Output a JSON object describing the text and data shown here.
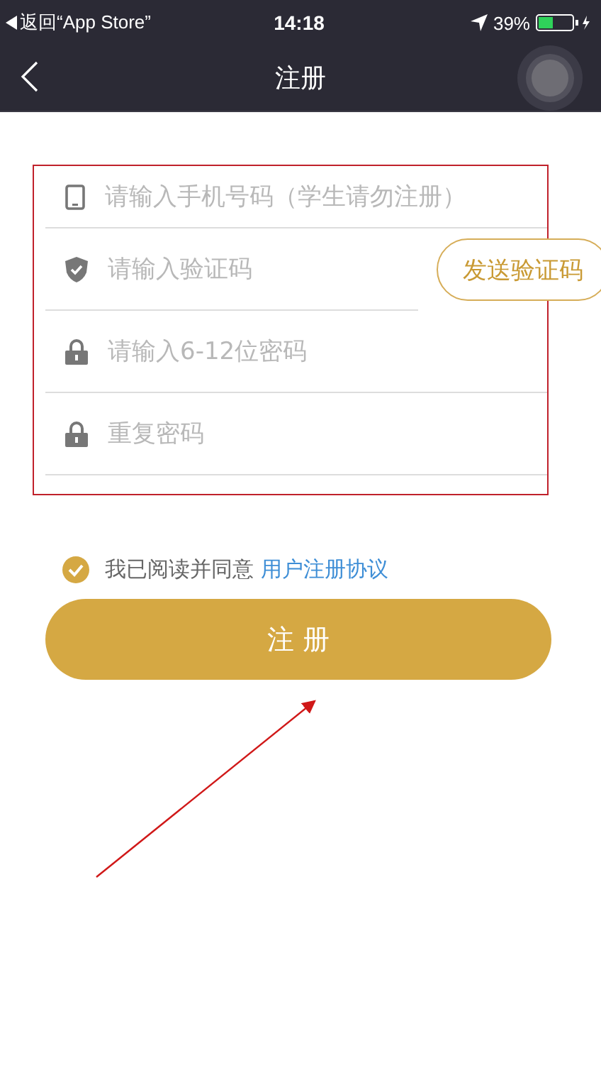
{
  "status_bar": {
    "back_label": "返回“App Store”",
    "time": "14:18",
    "battery": "39%"
  },
  "nav": {
    "title": "注册"
  },
  "form": {
    "fields": [
      {
        "kind": "phone",
        "placeholder": "请输入手机号码（学生请勿注册）"
      },
      {
        "kind": "code",
        "placeholder": "请输入验证码",
        "button": "发送验证码"
      },
      {
        "kind": "password",
        "placeholder": "请输入6-12位密码"
      },
      {
        "kind": "password",
        "placeholder": "重复密码"
      }
    ]
  },
  "agreement": {
    "checked": true,
    "text": "我已阅读并同意",
    "link": "用户注册协议"
  },
  "submit": {
    "label": "注 册"
  }
}
